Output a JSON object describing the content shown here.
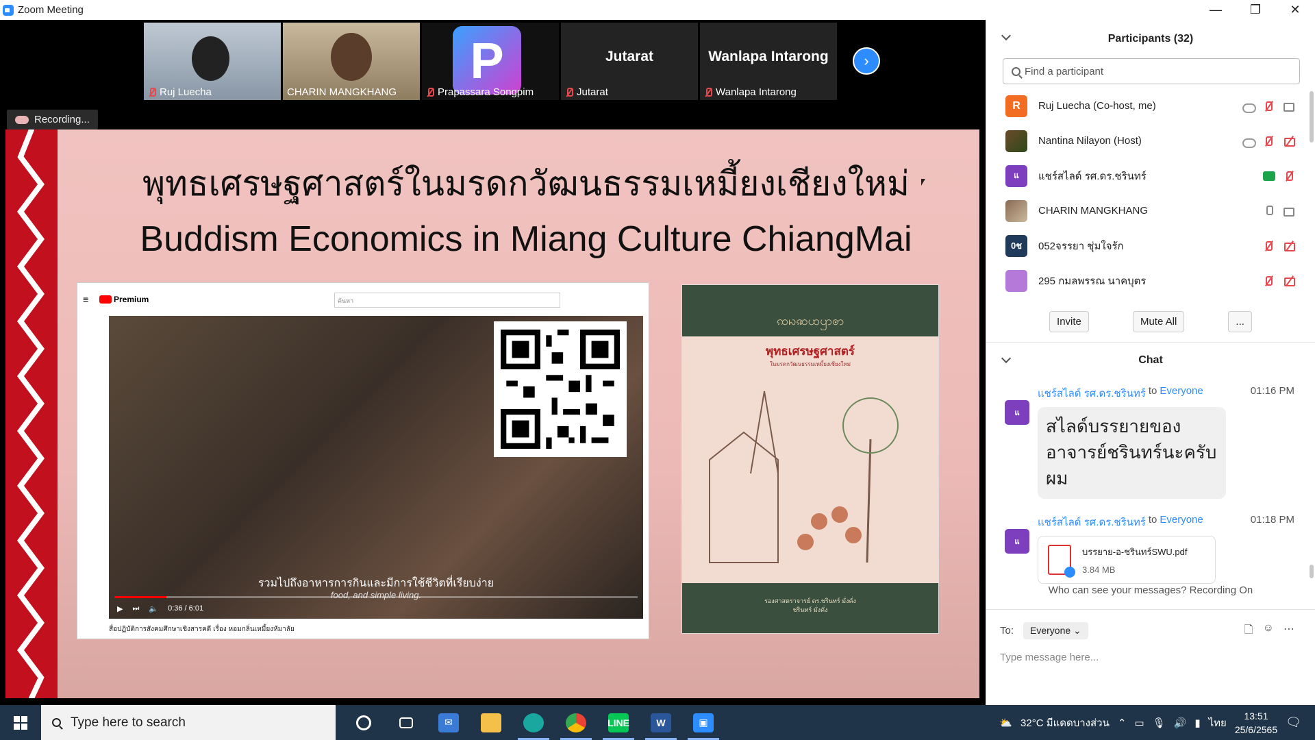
{
  "window": {
    "title": "Zoom Meeting",
    "minimize": "—",
    "restore": "❐",
    "close": "✕"
  },
  "gallery": {
    "tiles": [
      {
        "name": "Ruj Luecha"
      },
      {
        "name": "CHARIN MANGKHANG"
      },
      {
        "name": "Prapassara Songpim"
      },
      {
        "name": "Jutarat",
        "big": "Jutarat"
      },
      {
        "name": "Wanlapa Intarong",
        "big": "Wanlapa Intarong"
      }
    ],
    "next_icon": "›"
  },
  "recording": {
    "label": "Recording..."
  },
  "slide": {
    "thai_title": "พุทธเศรษฐศาสตร์ในมรดกวัฒนธรรมเหมี้ยงเชียงใหม่",
    "en_title": "Buddism Economics in Miang Culture ChiangMai",
    "youtube": {
      "logo": "Premium",
      "search_placeholder": "ค้นหา",
      "subtitle_th": "รวมไปถึงอาหารการกินและมีการใช้ชีวิตที่เรียบง่าย",
      "subtitle_en": "food, and simple living.",
      "time": "0:36 / 6:01",
      "caption": "สื่อปฏิบัติการสังคมศึกษาเชิงสารคดี เรื่อง หอมกลิ่นเหมี้ยงหัมาลัย",
      "progress_percent": 10
    },
    "book": {
      "top_text": "ꩡꩢꩣꩤꩥꩦ",
      "title": "พุทธเศรษฐศาสตร์",
      "subtitle": "ในมรดกวัฒนธรรมเหมี้ยงเชียงใหม่",
      "bottom_line1": "รองศาสตราจารย์ ดร.ชรินทร์ มั่งคั่ง",
      "bottom_line2": "ชรินทร์ มั่งคั่ง"
    }
  },
  "participants": {
    "header": "Participants (32)",
    "search_placeholder": "Find a participant",
    "list": [
      {
        "name": "Ruj Luecha (Co-host, me)",
        "initial": "R",
        "color": "#f26d21"
      },
      {
        "name": "Nantina Nilayon (Host)",
        "initial": "",
        "color": "#6b4a2a"
      },
      {
        "name": "แชร์สไลด์ รศ.ดร.ชรินทร์",
        "initial": "แ",
        "color": "#7e3fbf"
      },
      {
        "name": "CHARIN MANGKHANG",
        "initial": "",
        "color": "#8a6a55"
      },
      {
        "name": "052จรรยา ชุ่มใจรัก",
        "initial": "0ช",
        "color": "#1f3a5a"
      },
      {
        "name": "295 กมลพรรณ นาคบุตร",
        "initial": "",
        "color": "#b57ad9"
      }
    ],
    "invite": "Invite",
    "mute_all": "Mute All",
    "more": "..."
  },
  "chat": {
    "header": "Chat",
    "messages": [
      {
        "sender": "แชร์สไลด์ รศ.ดร.ชรินทร์",
        "to_word": "to",
        "recipient": "Everyone",
        "time": "01:16 PM",
        "text": "สไลด์บรรยายของอาจารย์ชรินทร์นะครับผม"
      },
      {
        "sender": "แชร์สไลด์ รศ.ดร.ชรินทร์",
        "to_word": "to",
        "recipient": "Everyone",
        "time": "01:18 PM",
        "file_name": "บรรยาย-อ-ชรินทร์SWU.pdf",
        "file_size": "3.84 MB"
      }
    ],
    "who_can_see": "Who can see your messages? Recording On",
    "to_label": "To:",
    "to_value": "Everyone",
    "placeholder": "Type message here...",
    "avatar_initial": "แ"
  },
  "taskbar": {
    "search_placeholder": "Type here to search",
    "apps": [
      "cortana",
      "task-view",
      "mail",
      "file-explorer",
      "edge",
      "chrome",
      "line",
      "word",
      "zoom"
    ],
    "weather": "32°C มีแดดบางส่วน",
    "language": "ไทย",
    "time": "13:51",
    "date": "25/6/2565"
  }
}
